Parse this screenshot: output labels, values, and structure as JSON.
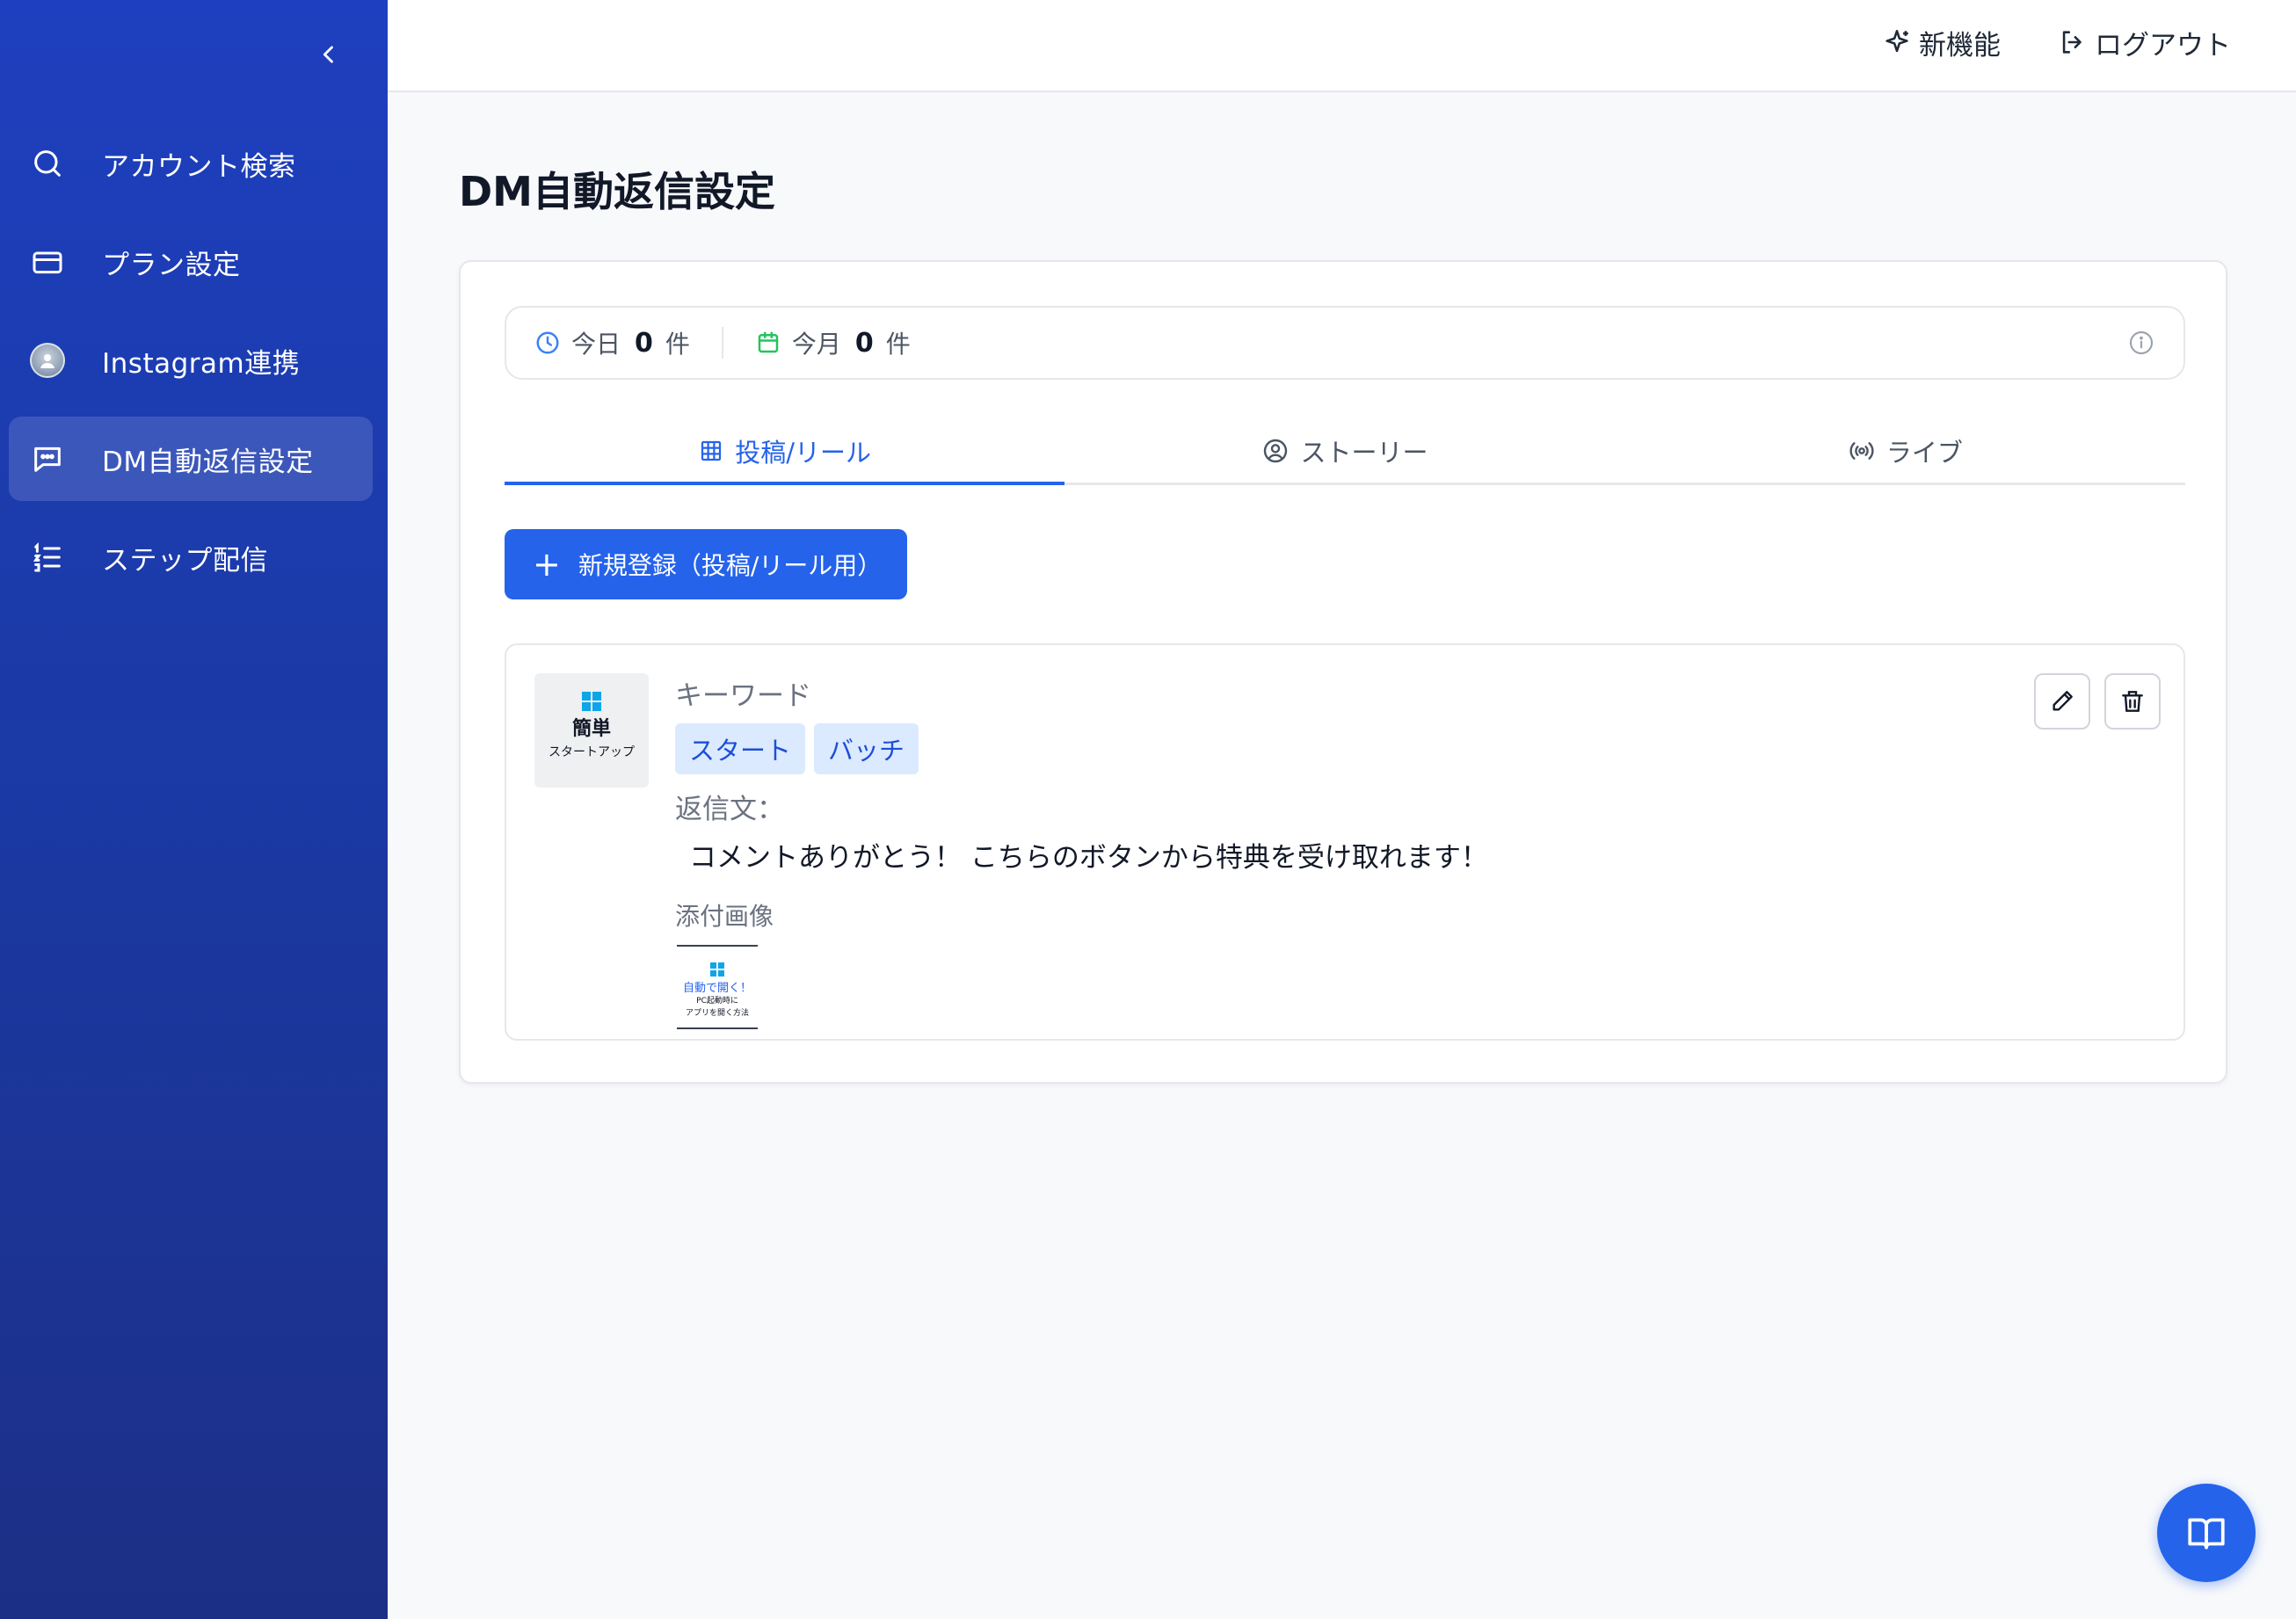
{
  "sidebar": {
    "items": [
      {
        "label": "アカウント検索",
        "icon": "search-icon"
      },
      {
        "label": "プラン設定",
        "icon": "credit-card-icon"
      },
      {
        "label": "Instagram連携",
        "icon": "avatar"
      },
      {
        "label": "DM自動返信設定",
        "icon": "message-square-icon",
        "active": true
      },
      {
        "label": "ステップ配信",
        "icon": "list-ordered-icon"
      }
    ]
  },
  "header": {
    "new_features": "新機能",
    "logout": "ログアウト"
  },
  "main": {
    "title": "DM自動返信設定",
    "stats": {
      "today_label": "今日",
      "today_count": "0",
      "today_unit": "件",
      "month_label": "今月",
      "month_count": "0",
      "month_unit": "件"
    },
    "tabs": [
      {
        "label": "投稿/リール",
        "active": true
      },
      {
        "label": "ストーリー"
      },
      {
        "label": "ライブ"
      }
    ],
    "add_button": "新規登録（投稿/リール用）",
    "rule": {
      "thumb_title": "簡単",
      "thumb_subtitle": "スタートアップ",
      "keyword_label": "キーワード",
      "keywords": [
        "スタート",
        "バッチ"
      ],
      "reply_label": "返信文：",
      "reply_text": "コメントありがとう！ こちらのボタンから特典を受け取れます！",
      "attach_label": "添付画像",
      "attach_line1": "自動で開く！",
      "attach_line2": "PC起動時に",
      "attach_line3": "アプリを開く方法"
    }
  },
  "colors": {
    "accent": "#2563eb",
    "sidebar_top": "#1e3fbf",
    "sidebar_bottom": "#1c2f86",
    "chip_bg": "#dbeafe"
  }
}
